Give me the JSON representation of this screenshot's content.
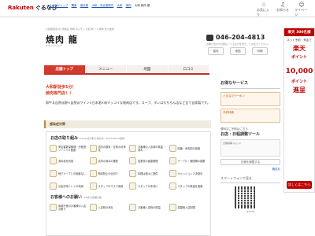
{
  "header": {
    "logo_brand": "Rakuten",
    "logo_name": "ぐるなび",
    "breadcrumbs": [
      "ぐるなびトップ",
      "関東",
      "東京都",
      "大和・河合橋周辺",
      "大和",
      "焼肉",
      "大和 焼肉 龍"
    ],
    "icons": [
      {
        "name": "favorite",
        "label": "お気に入り",
        "glyph": "☆"
      },
      {
        "name": "notice",
        "label": "お知らせ",
        "glyph": "♫"
      },
      {
        "name": "mypage",
        "label": "マイページ",
        "glyph": "☺"
      }
    ]
  },
  "shop": {
    "tagline": "大和駅徒歩1分 焼肉店 焼肉 ホルモン 大和 肉 一人焼肉 食べ放題",
    "name": "焼肉 龍",
    "kana": "ヤキニクリュウ",
    "phone": "046-204-4813",
    "phone_note": "お問い合わせの際は「ぐるなびを見た」とお伝えください。",
    "actions": [
      "保存",
      "地図",
      "印刷"
    ]
  },
  "tabs": [
    "店舗トップ",
    "メニュー",
    "地図",
    "口コミ"
  ],
  "catchcopy": [
    "大和駅徒歩1分！",
    "焼肉専門店！！"
  ],
  "description": "和牛＆自然派野×自然派ワイン×日本酒×肉マッコリな焼肉店です。スープ、タレはもちろん店など全て自家製です。",
  "section": "感染症対策",
  "measures": {
    "title": "お店の取り組み",
    "note": "24/48 店が取り組み中（2023/08/15更新）",
    "items": [
      "来店客数量管理・分散型ソーシャル配慮",
      "店内の換気・空気の清浄化",
      "お客様の入店時の検温・消毒",
      "除菌・消毒剤の設置",
      "消毒液を利用",
      "店内の消毒の徹底",
      "従業員の健康管理",
      "テーブル・席間隔の調整",
      "他グループとの相席なし",
      "飛沫防止の仕切り",
      "料理は個々に提供",
      "キャッシュレス決済可",
      "お会計時トレイの利用",
      "スタッフのマスク着用",
      "スタッフの手洗い",
      "スタッフの検温を実施"
    ],
    "customers_title": "お客様へのお願い",
    "customers_note": "4/6件の店舗の数",
    "customers_items": [
      "体調不良のお客様の入店お断り",
      "入店時の消毒",
      "お客様入店時の検温",
      "混雑時入店制限"
    ]
  },
  "sidebar": {
    "service_title": "お得なサービス",
    "service_coupons": [
      "ぐるなびクーポン",
      "予約特典"
    ],
    "tool_sub": "便利なご予約はこちら",
    "tool_title": "お店・日程調整ツール",
    "table_text": "日程候補 ◎○△×",
    "button": "日程を調整する",
    "link": "諏訪丸",
    "phone_title": "スマートフォンで見る",
    "qr_note": "@2535"
  },
  "ad": {
    "badge": "楽天 300名様",
    "line1": "ネット予約・来店で",
    "big1": "楽天",
    "mid": "ポイント",
    "big2": "10,000",
    "mid2": "ポイント",
    "mid3": "進呈",
    "foot": "詳しくはこちら"
  },
  "colors": {
    "brand": "#bf0000",
    "tab_active": "#d33a2c",
    "catch": "#d83b1d"
  }
}
